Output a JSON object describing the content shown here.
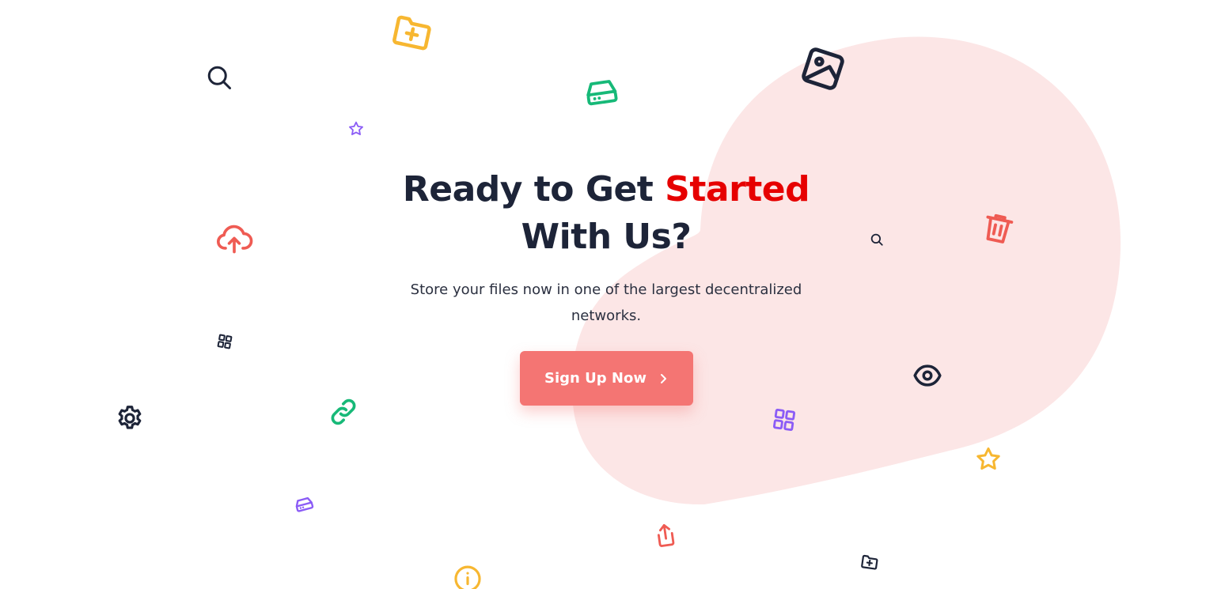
{
  "hero": {
    "title_line1_prefix": "Ready to Get ",
    "title_line1_accent": "Started",
    "title_line2": "With Us?",
    "subtitle": "Store your files now in one of the largest decentralized networks.",
    "cta_label": "Sign Up Now"
  },
  "colors": {
    "heading": "#1d2438",
    "accent_text": "#e60000",
    "cta_background": "#f47573",
    "blob": "#fce6e6",
    "icon_yellow": "#f7b731",
    "icon_green": "#17b978",
    "icon_purple": "#8b5cf6",
    "icon_red": "#ef5b53",
    "icon_navy": "#1d2438"
  },
  "decorations": [
    {
      "name": "folder-plus-icon",
      "color": "yellow"
    },
    {
      "name": "search-icon",
      "color": "navy"
    },
    {
      "name": "hard-drive-icon",
      "color": "green"
    },
    {
      "name": "image-icon",
      "color": "navy"
    },
    {
      "name": "star-icon",
      "color": "purple"
    },
    {
      "name": "trash-icon",
      "color": "red"
    },
    {
      "name": "cloud-upload-icon",
      "color": "red"
    },
    {
      "name": "search-icon",
      "color": "navy"
    },
    {
      "name": "grid-icon",
      "color": "navy"
    },
    {
      "name": "eye-icon",
      "color": "navy"
    },
    {
      "name": "gear-icon",
      "color": "navy"
    },
    {
      "name": "link-icon",
      "color": "green"
    },
    {
      "name": "grid-icon",
      "color": "purple"
    },
    {
      "name": "star-icon",
      "color": "yellow"
    },
    {
      "name": "hard-drive-icon",
      "color": "purple"
    },
    {
      "name": "share-icon",
      "color": "red"
    },
    {
      "name": "folder-plus-icon",
      "color": "navy"
    },
    {
      "name": "info-icon",
      "color": "yellow"
    }
  ]
}
